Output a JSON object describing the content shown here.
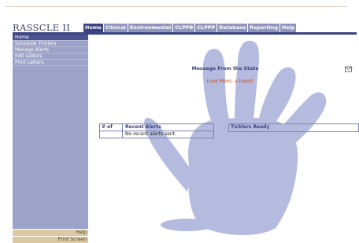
{
  "app": {
    "title": "RASSCLE II"
  },
  "tabs": [
    {
      "label": "Home",
      "active": true
    },
    {
      "label": "Clinical"
    },
    {
      "label": "Environmental"
    },
    {
      "label": "CLPPB"
    },
    {
      "label": "CLPPP"
    },
    {
      "label": "Database"
    },
    {
      "label": "Reporting"
    },
    {
      "label": "Help"
    }
  ],
  "sidebar": {
    "items": [
      {
        "label": "Home",
        "active": true
      },
      {
        "label": "Schedule Ticklers"
      },
      {
        "label": "Manage Alerts"
      },
      {
        "label": "Edit Letters"
      },
      {
        "label": "Print Letters"
      }
    ],
    "help_label": "Help",
    "print_label": "Print Screen"
  },
  "message": {
    "heading": "Message From the State",
    "body": "Look Mom, a hand!"
  },
  "alerts": {
    "col_num": "# of",
    "col_title": "Recent Alerts",
    "empty_text": "No recent alerts sent."
  },
  "ticklers": {
    "title": "Ticklers Ready"
  },
  "colors": {
    "active_tab": "#3b4380",
    "tab": "#8f95bd",
    "sidebar": "#9da3c8",
    "hand": "#a8b0da",
    "message_body": "#d14a10"
  }
}
